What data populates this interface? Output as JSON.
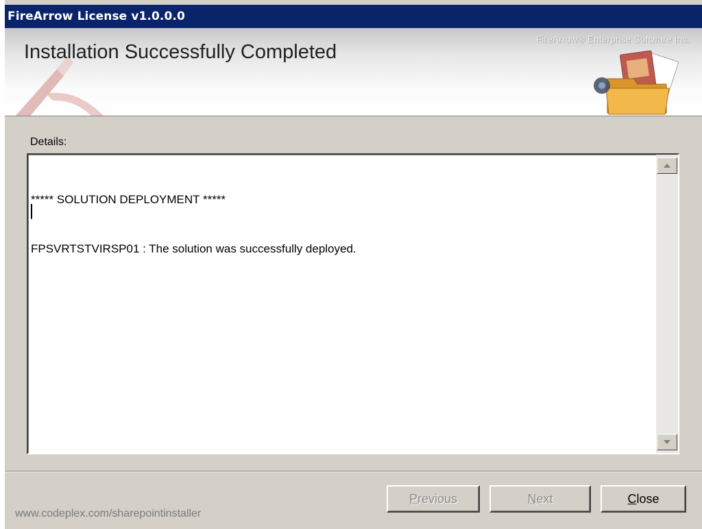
{
  "window": {
    "title": "FireArrow License v1.0.0.0"
  },
  "banner": {
    "title": "Installation Successfully Completed",
    "company": "FireArrow® Enterprise Software Inc."
  },
  "details": {
    "label": "Details:",
    "lines": [
      "***** SOLUTION DEPLOYMENT *****",
      "FPSVRTSTVIRSP01 : The solution was successfully deployed."
    ]
  },
  "buttons": {
    "previous": {
      "mnemonic": "P",
      "rest": "revious",
      "enabled": false
    },
    "next": {
      "mnemonic": "N",
      "rest": "ext",
      "enabled": false
    },
    "close": {
      "mnemonic": "C",
      "rest": "lose",
      "enabled": true
    }
  },
  "footer": {
    "link": "www.codeplex.com/sharepointinstaller"
  },
  "colors": {
    "titlebar": "#0a246a",
    "face": "#d4d0c8",
    "logo_red": "#c0403a"
  },
  "icons": [
    "firearrow-logo-icon",
    "folder-icon",
    "scroll-up-arrow-icon",
    "scroll-down-arrow-icon"
  ]
}
